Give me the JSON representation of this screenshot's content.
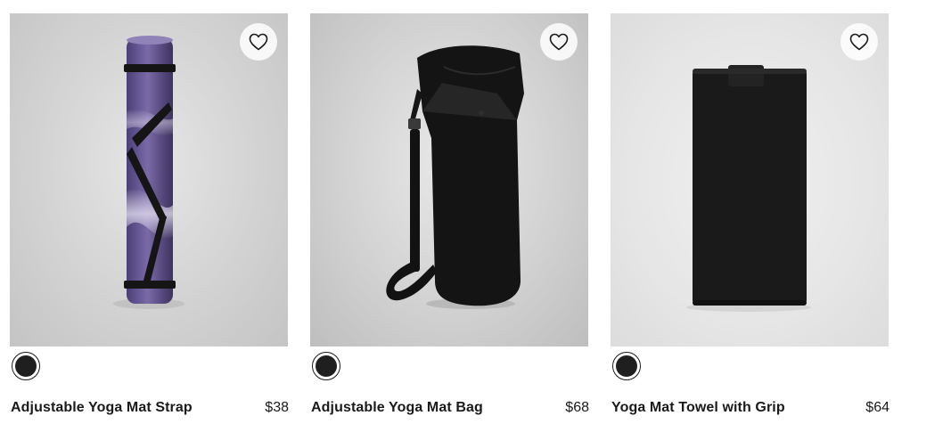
{
  "products": [
    {
      "name": "Adjustable Yoga Mat Strap",
      "price": "$38",
      "swatch_color": "#1f1f1f",
      "wishlist_icon": "heart-outline-icon"
    },
    {
      "name": "Adjustable Yoga Mat Bag",
      "price": "$68",
      "swatch_color": "#1f1f1f",
      "wishlist_icon": "heart-outline-icon"
    },
    {
      "name": "Yoga Mat Towel with Grip",
      "price": "$64",
      "swatch_color": "#1f1f1f",
      "wishlist_icon": "heart-outline-icon"
    }
  ]
}
